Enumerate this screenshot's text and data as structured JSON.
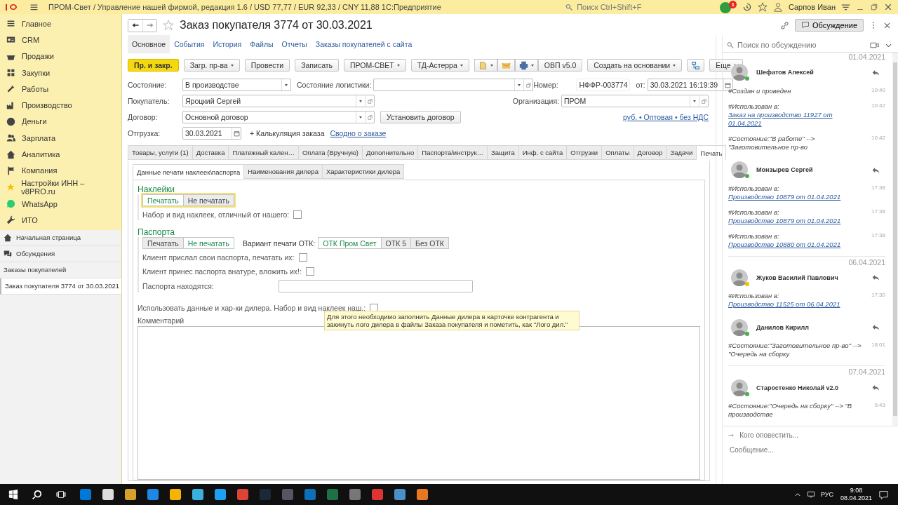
{
  "app_bar": {
    "title": "ПРОМ-Свет / Управление нашей фирмой, редакция 1.6 / USD 77,77 / EUR 92,33 / CNY 11,88 1С:Предприятие",
    "search": {
      "placeholder": "Поиск Ctrl+Shift+F"
    },
    "notifications": "1",
    "user": "Сарпов Иван"
  },
  "sidebar": {
    "sections": [
      {
        "label": "Главное"
      },
      {
        "label": "CRM"
      },
      {
        "label": "Продажи"
      },
      {
        "label": "Закупки"
      },
      {
        "label": "Работы"
      },
      {
        "label": "Производство"
      },
      {
        "label": "Деньги"
      },
      {
        "label": "Зарплата"
      },
      {
        "label": "Аналитика"
      },
      {
        "label": "Компания"
      },
      {
        "label": "Настройки ИНН – v8PRO.ru"
      },
      {
        "label": "WhatsApp"
      },
      {
        "label": "ИТО"
      }
    ],
    "windows": [
      {
        "label": "Начальная страница",
        "kind": "home",
        "selected": false
      },
      {
        "label": "Обсуждения",
        "kind": "discussions",
        "selected": false
      },
      {
        "label": "Заказы покупателей",
        "kind": "list",
        "selected": false
      },
      {
        "label": "Заказ покупателя 3774 от 30.03.2021",
        "kind": "list",
        "selected": true
      }
    ]
  },
  "form": {
    "title": "Заказ покупателя 3774 от 30.03.2021",
    "discussion_toggle": {
      "label": "Обсуждение",
      "selected": true
    },
    "nav_tabs": [
      {
        "label": "Основное",
        "selected": true
      },
      {
        "label": "События",
        "selected": false
      },
      {
        "label": "История",
        "selected": false
      },
      {
        "label": "Файлы",
        "selected": false
      },
      {
        "label": "Отчеты",
        "selected": false
      },
      {
        "label": "Заказы покупателей с сайта",
        "selected": false
      }
    ],
    "toolbar": [
      {
        "label": "Пр. и закр.",
        "kind": "primary"
      },
      {
        "label": "Загр. пр-ва",
        "kind": "dropdown"
      },
      {
        "label": "Провести",
        "kind": "button"
      },
      {
        "label": "Записать",
        "kind": "button"
      },
      {
        "label": "ПРОМ-СВЕТ",
        "kind": "dropdown"
      },
      {
        "label": "ТД-Астерра",
        "kind": "dropdown"
      },
      {
        "kind": "icons"
      },
      {
        "label": "ОВП v5.0",
        "kind": "attached"
      },
      {
        "label": "Создать на основании",
        "kind": "dropdown"
      },
      {
        "kind": "icon"
      },
      {
        "label": "Еще",
        "kind": "more"
      }
    ],
    "state": {
      "label": "Состояние:",
      "value": "В производстве"
    },
    "logistics": {
      "label": "Состояние логистики:"
    },
    "number": {
      "label": "Номер:",
      "value": "НФФР-003774"
    },
    "date": {
      "label": "от:",
      "value": "30.03.2021 16:19:39"
    },
    "customer": {
      "label": "Покупатель:",
      "value": "Яроцкий Сергей"
    },
    "organization": {
      "label": "Организация:",
      "value": "ПРОМ"
    },
    "contract": {
      "label": "Договор:",
      "value": "Основной договор"
    },
    "set_contract": "Установить договор",
    "price_link": "руб. • Оптовая • без НДС",
    "shipment": {
      "label": "Отгрузка:",
      "value": "30.03.2021"
    },
    "calc_link": "+ Калькуляция заказа",
    "summary_link": "Сводно о заказе",
    "tabs": [
      {
        "label": "Товары, услуги (1)",
        "selected": false
      },
      {
        "label": "Доставка",
        "selected": false
      },
      {
        "label": "Платежный кален…",
        "selected": false
      },
      {
        "label": "Оплата (Вручную)",
        "selected": false
      },
      {
        "label": "Дополнительно",
        "selected": false
      },
      {
        "label": "Паспорта/инструк…",
        "selected": false
      },
      {
        "label": "Защита",
        "selected": false
      },
      {
        "label": "Инф. с сайта",
        "selected": false
      },
      {
        "label": "Отгрузки",
        "selected": false
      },
      {
        "label": "Оплаты",
        "selected": false
      },
      {
        "label": "Договор",
        "selected": false
      },
      {
        "label": "Задачи",
        "selected": false
      },
      {
        "label": "Печать",
        "selected": true
      }
    ],
    "subtabs": [
      {
        "label": "Данные печати наклеек\\паспорта",
        "selected": true
      },
      {
        "label": "Наименования дилера",
        "selected": false
      },
      {
        "label": "Характеристики дилера",
        "selected": false
      }
    ],
    "stickers": {
      "title": "Наклейки",
      "toggle": [
        {
          "label": "Печатать",
          "selected": true
        },
        {
          "label": "Не печатать",
          "selected": false
        }
      ],
      "checkbox": {
        "label": "Набор и вид наклеек, отличный от нашего:",
        "checked": false
      }
    },
    "passports": {
      "title": "Паспорта",
      "toggle": [
        {
          "label": "Печатать",
          "selected": false
        },
        {
          "label": "Не печатать",
          "selected": true
        }
      ],
      "otk_label": "Вариант печати ОТК:",
      "otk_toggle": [
        {
          "label": "ОТК Пром Свет",
          "selected": true
        },
        {
          "label": "ОТК 5",
          "selected": false
        },
        {
          "label": "Без ОТК",
          "selected": false
        }
      ],
      "checkboxes": [
        {
          "label": "Клиент прислал свои паспорта, печатать их:",
          "checked": false
        },
        {
          "label": "Клиент принес паспорта внатуре, вложить их!:",
          "checked": false
        }
      ],
      "location_label": "Паспорта находятся:"
    },
    "dealer_checkbox": {
      "label": "Использовать данные и хар-ки дилера. Набор и вид наклеек наш.:",
      "checked": false
    },
    "tooltip": "Для этого необходимо заполнить Данные дилера в карточке контрагента и закинуть лого дилера в файлы Заказа покупателя и пометить, как \"Лого дил.\"",
    "comment_label": "Комментарий"
  },
  "discussion": {
    "search": {
      "placeholder": "Поиск по обсуждению"
    },
    "feed": [
      {
        "kind": "date",
        "text": "01.04.2021"
      },
      {
        "kind": "author",
        "name": "Шефатов Алексей",
        "color": "#4caf50"
      },
      {
        "kind": "message",
        "text": "#Создан и проведен",
        "time": "10:40"
      },
      {
        "kind": "message",
        "text": "#Использован в: ",
        "link": "Заказ на производство 11927 от 01.04.2021",
        "time": "10:42"
      },
      {
        "kind": "message",
        "text": "#Состояние:\"В работе\" --> \"Заготовительное пр-во",
        "time": "10:42"
      },
      {
        "kind": "author",
        "name": "Монзырев Сергей",
        "color": "#4caf50"
      },
      {
        "kind": "message",
        "text": "#Использован в: ",
        "link": "Производство 10879 от 01.04.2021",
        "time": "17:38"
      },
      {
        "kind": "message",
        "text": "#Использован в: ",
        "link": "Производство 10879 от 01.04.2021",
        "time": "17:38"
      },
      {
        "kind": "message",
        "text": "#Использован в: ",
        "link": "Производство 10880 от 01.04.2021",
        "time": "17:38"
      },
      {
        "kind": "date",
        "text": "06.04.2021"
      },
      {
        "kind": "author",
        "name": "Жуков Василий Павлович",
        "color": "#f2c200"
      },
      {
        "kind": "message",
        "text": "#Использован в: ",
        "link": "Производство 11525 от 06.04.2021",
        "time": "17:30"
      },
      {
        "kind": "author",
        "name": "Данилов Кирилл",
        "color": "#4caf50"
      },
      {
        "kind": "message",
        "text": "#Состояние:\"Заготовительное пр-во\" --> \"Очередь на сборку",
        "time": "18:01"
      },
      {
        "kind": "date",
        "text": "07.04.2021"
      },
      {
        "kind": "author",
        "name": "Старостенко Николай v2.0",
        "color": "#4caf50"
      },
      {
        "kind": "message",
        "text": "#Состояние:\"Очередь на сборку\" --> \"В производстве",
        "time": "9:43"
      }
    ],
    "notify_placeholder": "Кого оповестить...",
    "message_placeholder": "Сообщение..."
  },
  "taskbar": {
    "language": "РУС",
    "time": "9:08",
    "date": "08.04.2021"
  }
}
